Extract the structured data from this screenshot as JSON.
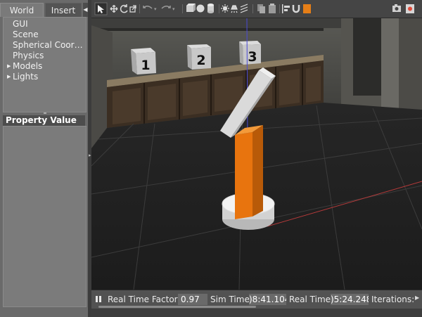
{
  "left_panel": {
    "tabs": [
      "World",
      "Insert"
    ],
    "tree": [
      {
        "label": "GUI",
        "expandable": false
      },
      {
        "label": "Scene",
        "expandable": false
      },
      {
        "label": "Spherical Coor…",
        "expandable": false
      },
      {
        "label": "Physics",
        "expandable": false
      },
      {
        "label": "Models",
        "expandable": true
      },
      {
        "label": "Lights",
        "expandable": true
      }
    ],
    "property_header": "Property Value"
  },
  "toolbar": {
    "icons": [
      "select-arrow-icon",
      "translate-icon",
      "rotate-icon",
      "scale-icon",
      "undo-icon",
      "redo-icon",
      "box-icon",
      "sphere-icon",
      "cylinder-icon",
      "point-light-icon",
      "spot-light-icon",
      "directional-light-icon",
      "copy-icon",
      "paste-icon",
      "align-icon",
      "magnet-icon",
      "orange-square-icon",
      "screenshot-icon",
      "record-icon"
    ],
    "active_icon": "select-arrow-icon"
  },
  "scene": {
    "boxes": [
      "1",
      "2",
      "3"
    ],
    "colors": {
      "arm": "#e8740e",
      "base": "#eeeeee",
      "floor": "#1e1e1e",
      "grid": "#3c3c3c",
      "x_axis": "#b53a3a",
      "z_axis": "#4b4bd6"
    }
  },
  "statusbar": {
    "real_time_factor_label": "Real Time Factor:",
    "real_time_factor_value": "0.97",
    "sim_time_label": "Sim Time:",
    "sim_time_value": ")8:41.104",
    "real_time_label": "Real Time:",
    "real_time_value": ")5:24.248",
    "iterations_label": "Iterations:"
  }
}
